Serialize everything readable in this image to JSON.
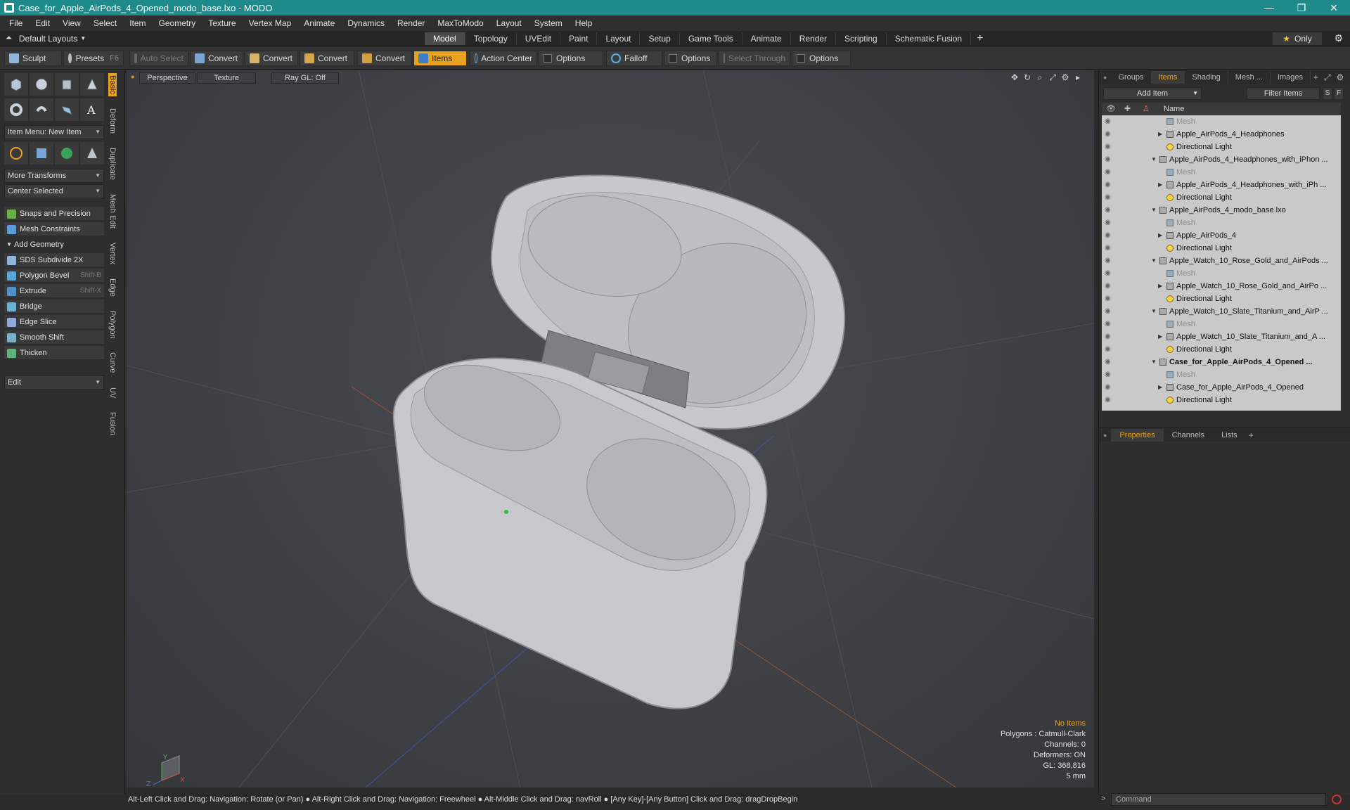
{
  "window": {
    "title": "Case_for_Apple_AirPods_4_Opened_modo_base.lxo - MODO",
    "controls": [
      "—",
      "❐",
      "✕"
    ]
  },
  "menu": [
    "File",
    "Edit",
    "View",
    "Select",
    "Item",
    "Geometry",
    "Texture",
    "Vertex Map",
    "Animate",
    "Dynamics",
    "Render",
    "MaxToModo",
    "Layout",
    "System",
    "Help"
  ],
  "layoutbar": {
    "default_layouts": "Default Layouts",
    "tabs": [
      "Model",
      "Topology",
      "UVEdit",
      "Paint",
      "Layout",
      "Setup",
      "Game Tools",
      "Animate",
      "Render",
      "Scripting",
      "Schematic Fusion"
    ],
    "active_tab": "Model",
    "only_label": "Only"
  },
  "toolbar": {
    "sculpt": "Sculpt",
    "presets": "Presets",
    "presets_key": "F6",
    "auto_select": "Auto Select",
    "convert1": "Convert",
    "convert2": "Convert",
    "convert3": "Convert",
    "convert4": "Convert",
    "items": "Items",
    "action_center": "Action Center",
    "options1": "Options",
    "falloff": "Falloff",
    "options2": "Options",
    "select_through": "Select Through",
    "options3": "Options"
  },
  "left": {
    "vtabs": [
      "Basic",
      "Deform",
      "Duplicate",
      "Mesh Edit",
      "Vertex",
      "Edge",
      "Polygon",
      "Curve",
      "UV",
      "Fusion"
    ],
    "item_menu": "Item Menu: New Item",
    "more_transforms": "More Transforms",
    "center_selected": "Center Selected",
    "snaps": "Snaps and Precision",
    "mesh_constraints": "Mesh Constraints",
    "add_geometry": "Add Geometry",
    "tools": [
      {
        "label": "SDS Subdivide 2X",
        "shortcut": ""
      },
      {
        "label": "Polygon Bevel",
        "shortcut": "Shift-B"
      },
      {
        "label": "Extrude",
        "shortcut": "Shift-X"
      },
      {
        "label": "Bridge",
        "shortcut": ""
      },
      {
        "label": "Edge Slice",
        "shortcut": ""
      },
      {
        "label": "Smooth Shift",
        "shortcut": ""
      },
      {
        "label": "Thicken",
        "shortcut": ""
      }
    ],
    "edit": "Edit"
  },
  "viewport": {
    "perspective": "Perspective",
    "texture": "Texture",
    "raygl": "Ray GL: Off",
    "stats": {
      "no_items": "No Items",
      "polygons": "Polygons : Catmull-Clark",
      "channels": "Channels: 0",
      "deformers": "Deformers: ON",
      "gl": "GL: 368,816",
      "scale": "5 mm"
    },
    "axis_x": "X",
    "axis_y": "Y",
    "axis_z": "Z"
  },
  "right": {
    "tabs": [
      "Groups",
      "Items",
      "Shading",
      "Mesh ...",
      "Images"
    ],
    "active_tab": "Items",
    "add_item": "Add Item",
    "filter_items": "Filter Items",
    "s_btn": "S",
    "f_btn": "F",
    "name_col": "Name",
    "tree": [
      {
        "label": "Mesh",
        "level": 2,
        "kind": "mesh",
        "dim": true,
        "arrow": ""
      },
      {
        "label": "Apple_AirPods_4_Headphones",
        "level": 2,
        "kind": "item",
        "arrow": "▶"
      },
      {
        "label": "Directional Light",
        "level": 2,
        "kind": "light",
        "arrow": ""
      },
      {
        "label": "Apple_AirPods_4_Headphones_with_iPhon ...",
        "level": 1,
        "kind": "scene",
        "arrow": "▼"
      },
      {
        "label": "Mesh",
        "level": 2,
        "kind": "mesh",
        "dim": true,
        "arrow": ""
      },
      {
        "label": "Apple_AirPods_4_Headphones_with_iPh ...",
        "level": 2,
        "kind": "item",
        "arrow": "▶"
      },
      {
        "label": "Directional Light",
        "level": 2,
        "kind": "light",
        "arrow": ""
      },
      {
        "label": "Apple_AirPods_4_modo_base.lxo",
        "level": 1,
        "kind": "scene",
        "arrow": "▼"
      },
      {
        "label": "Mesh",
        "level": 2,
        "kind": "mesh",
        "dim": true,
        "arrow": ""
      },
      {
        "label": "Apple_AirPods_4",
        "level": 2,
        "kind": "item",
        "arrow": "▶"
      },
      {
        "label": "Directional Light",
        "level": 2,
        "kind": "light",
        "arrow": ""
      },
      {
        "label": "Apple_Watch_10_Rose_Gold_and_AirPods ...",
        "level": 1,
        "kind": "scene",
        "arrow": "▼"
      },
      {
        "label": "Mesh",
        "level": 2,
        "kind": "mesh",
        "dim": true,
        "arrow": ""
      },
      {
        "label": "Apple_Watch_10_Rose_Gold_and_AirPo ...",
        "level": 2,
        "kind": "item",
        "arrow": "▶"
      },
      {
        "label": "Directional Light",
        "level": 2,
        "kind": "light",
        "arrow": ""
      },
      {
        "label": "Apple_Watch_10_Slate_Titanium_and_AirP ...",
        "level": 1,
        "kind": "scene",
        "arrow": "▼"
      },
      {
        "label": "Mesh",
        "level": 2,
        "kind": "mesh",
        "dim": true,
        "arrow": ""
      },
      {
        "label": "Apple_Watch_10_Slate_Titanium_and_A ...",
        "level": 2,
        "kind": "item",
        "arrow": "▶"
      },
      {
        "label": "Directional Light",
        "level": 2,
        "kind": "light",
        "arrow": ""
      },
      {
        "label": "Case_for_Apple_AirPods_4_Opened ...",
        "level": 1,
        "kind": "scene",
        "arrow": "▼",
        "bold": true
      },
      {
        "label": "Mesh",
        "level": 2,
        "kind": "mesh",
        "dim": true,
        "arrow": ""
      },
      {
        "label": "Case_for_Apple_AirPods_4_Opened",
        "level": 2,
        "kind": "item",
        "arrow": "▶"
      },
      {
        "label": "Directional Light",
        "level": 2,
        "kind": "light",
        "arrow": ""
      }
    ],
    "prop_tabs": [
      "Properties",
      "Channels",
      "Lists"
    ],
    "active_prop_tab": "Properties"
  },
  "statusbar": "Alt-Left Click and Drag: Navigation: Rotate (or Pan) ● Alt-Right Click and Drag: Navigation: Freewheel ● Alt-Middle Click and Drag: navRoll ● [Any Key]-[Any Button] Click and Drag: dragDropBegin",
  "command_placeholder": "Command",
  "colors": {
    "accent": "#e9a21b",
    "titlebar": "#1e8a89",
    "viewport_bg": "#3e4145",
    "tree_bg": "#c9c9c9"
  }
}
